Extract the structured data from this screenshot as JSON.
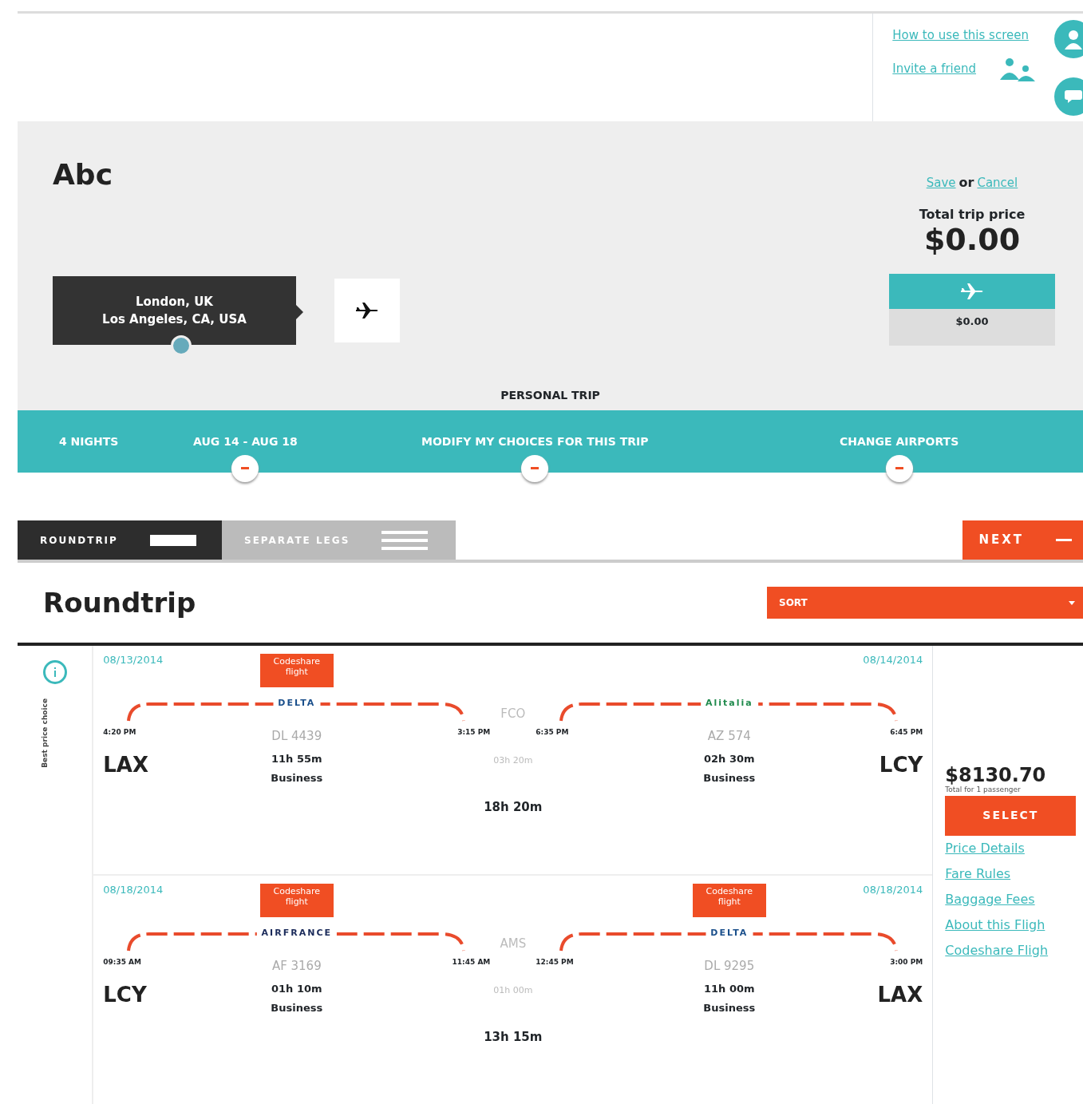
{
  "header": {
    "links": [
      {
        "label": "How to use this screen",
        "kind": "help"
      },
      {
        "label": "Invite a friend",
        "kind": "invite"
      }
    ]
  },
  "trip": {
    "title": "Abc",
    "route": [
      "London, UK",
      "Los Angeles, CA, USA"
    ],
    "save": "Save",
    "or": "or",
    "cancel": "Cancel",
    "price_label": "Total trip price",
    "price": "$0.00",
    "flight_price": "$0.00",
    "trip_type": "PERSONAL TRIP"
  },
  "options_bar": [
    {
      "label": "4 NIGHTS",
      "toggle": false
    },
    {
      "label": "AUG 14 - AUG 18",
      "toggle": true
    },
    {
      "label": "MODIFY MY CHOICES FOR THIS TRIP",
      "toggle": true
    },
    {
      "label": "CHANGE AIRPORTS",
      "toggle": true
    }
  ],
  "view_tabs": [
    {
      "label": "ROUNDTRIP",
      "selected": true
    },
    {
      "label": "SEPARATE LEGS",
      "selected": false
    }
  ],
  "next": "NEXT",
  "results": {
    "title": "Roundtrip",
    "sort": "SORT",
    "side_label": "Best price choice",
    "offers": [
      {
        "price": "$8130.70",
        "price_note": "Total for 1 passenger",
        "select": "SELECT",
        "links": [
          "Price Details",
          "Fare Rules",
          "Baggage Fees",
          "About this Fligh",
          "Codeshare Fligh"
        ],
        "legs": [
          {
            "date_start": "08/13/2014",
            "date_end": "08/14/2014",
            "from": "LAX",
            "to": "LCY",
            "total": "18h 20m",
            "segments": [
              {
                "codeshare": "Codeshare flight",
                "airline": "DELTA",
                "color": "#1a4f8b",
                "flight": "DL 4439",
                "depart": "4:20 PM",
                "arrive": "3:15 PM",
                "duration": "11h 55m",
                "cabin": "Business"
              },
              {
                "airline": "Alitalia",
                "color": "#1f8a4c",
                "flight": "AZ 574",
                "depart": "6:35 PM",
                "arrive": "6:45 PM",
                "duration": "02h 30m",
                "cabin": "Business"
              }
            ],
            "layovers": [
              {
                "airport": "FCO",
                "duration": "03h 20m"
              }
            ]
          },
          {
            "date_start": "08/18/2014",
            "date_end": "08/18/2014",
            "from": "LCY",
            "to": "LAX",
            "total": "13h 15m",
            "segments": [
              {
                "codeshare": "Codeshare flight",
                "airline": "AIRFRANCE",
                "color": "#1a2a5a",
                "flight": "AF 3169",
                "depart": "09:35 AM",
                "arrive": "11:45 AM",
                "duration": "01h 10m",
                "cabin": "Business"
              },
              {
                "codeshare": "Codeshare flight",
                "airline": "DELTA",
                "color": "#1a4f8b",
                "flight": "DL 9295",
                "depart": "12:45 PM",
                "arrive": "3:00 PM",
                "duration": "11h 00m",
                "cabin": "Business"
              }
            ],
            "layovers": [
              {
                "airport": "AMS",
                "duration": "01h 00m"
              }
            ]
          }
        ]
      }
    ]
  }
}
